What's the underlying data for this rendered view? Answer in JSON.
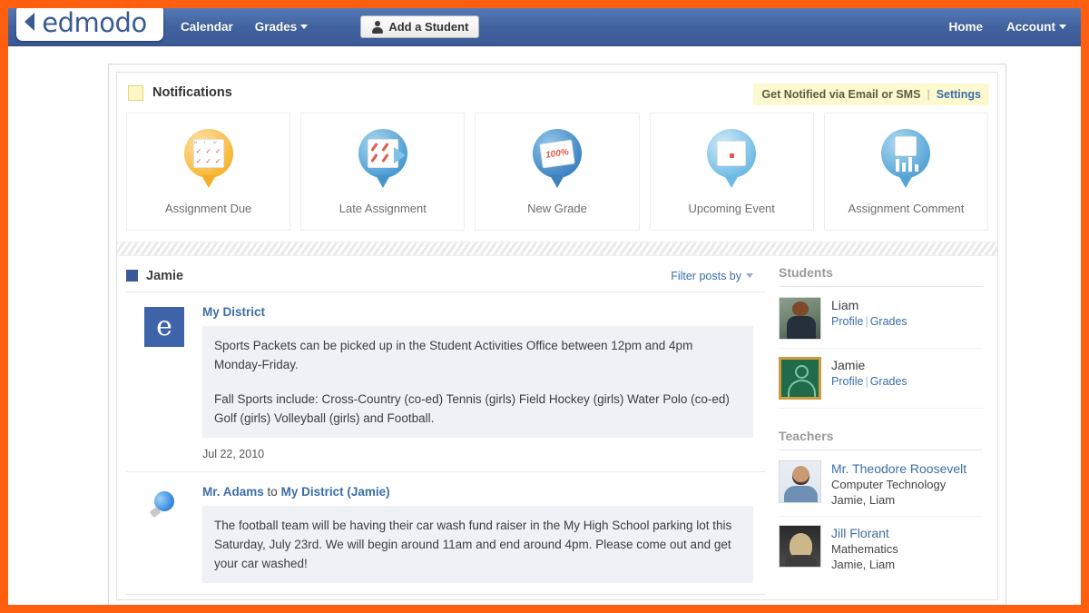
{
  "brand": {
    "name": "edmodo",
    "logo_mark": "chevron-left",
    "accent": "#ff5f0f",
    "nav_bg": "#3a5a96"
  },
  "topnav": {
    "left_links": [
      {
        "label": "Calendar",
        "caret": false
      },
      {
        "label": "Grades",
        "caret": true
      }
    ],
    "add_student_button": "Add a Student",
    "right_links": [
      {
        "label": "Home",
        "caret": false
      },
      {
        "label": "Account",
        "caret": true
      }
    ]
  },
  "notifications": {
    "title": "Notifications",
    "get_notified_text": "Get Notified via Email or SMS",
    "separator": "|",
    "settings_label": "Settings",
    "cards": [
      {
        "label": "Assignment Due",
        "icon": "calendar-check-pin-icon"
      },
      {
        "label": "Late Assignment",
        "icon": "late-assignment-pin-icon"
      },
      {
        "label": "New Grade",
        "icon": "grade-100-percent-pin-icon"
      },
      {
        "label": "Upcoming Event",
        "icon": "calendar-event-pin-icon"
      },
      {
        "label": "Assignment Comment",
        "icon": "assignment-comment-pin-icon"
      }
    ]
  },
  "feed": {
    "child_name": "Jamie",
    "filter_label": "Filter posts by",
    "posts": [
      {
        "avatar": "edmodo-e-badge",
        "author": "My District",
        "author_suffix": "",
        "target": "",
        "paragraphs": [
          "Sports Packets can be picked up in the Student Activities Office between 12pm and 4pm Monday-Friday.",
          "Fall Sports include: Cross-Country (co-ed) Tennis (girls) Field Hockey (girls) Water Polo (co-ed) Golf (girls) Volleyball (girls) and Football."
        ],
        "date": "Jul 22, 2010"
      },
      {
        "avatar": "lightbulb-icon",
        "author": "Mr. Adams",
        "author_suffix": "to",
        "target": "My District (Jamie)",
        "paragraphs": [
          "The football team will be having their car wash fund raiser in the My High School parking lot this Saturday, July 23rd. We will begin around 11am and end around 4pm. Please come out and get your car washed!"
        ],
        "date": ""
      }
    ]
  },
  "sidebar": {
    "students_heading": "Students",
    "students": [
      {
        "name": "Liam",
        "avatar": "student-photo-liam",
        "profile_label": "Profile",
        "separator": "|",
        "grades_label": "Grades"
      },
      {
        "name": "Jamie",
        "avatar": "student-placeholder-jamie",
        "profile_label": "Profile",
        "separator": "|",
        "grades_label": "Grades"
      }
    ],
    "teachers_heading": "Teachers",
    "teachers": [
      {
        "name": "Mr. Theodore Roosevelt",
        "subject": "Computer Technology",
        "students": "Jamie, Liam",
        "avatar": "teacher-photo-roosevelt"
      },
      {
        "name": "Jill Florant",
        "subject": "Mathematics",
        "students": "Jamie, Liam",
        "avatar": "teacher-photo-florant"
      }
    ]
  }
}
